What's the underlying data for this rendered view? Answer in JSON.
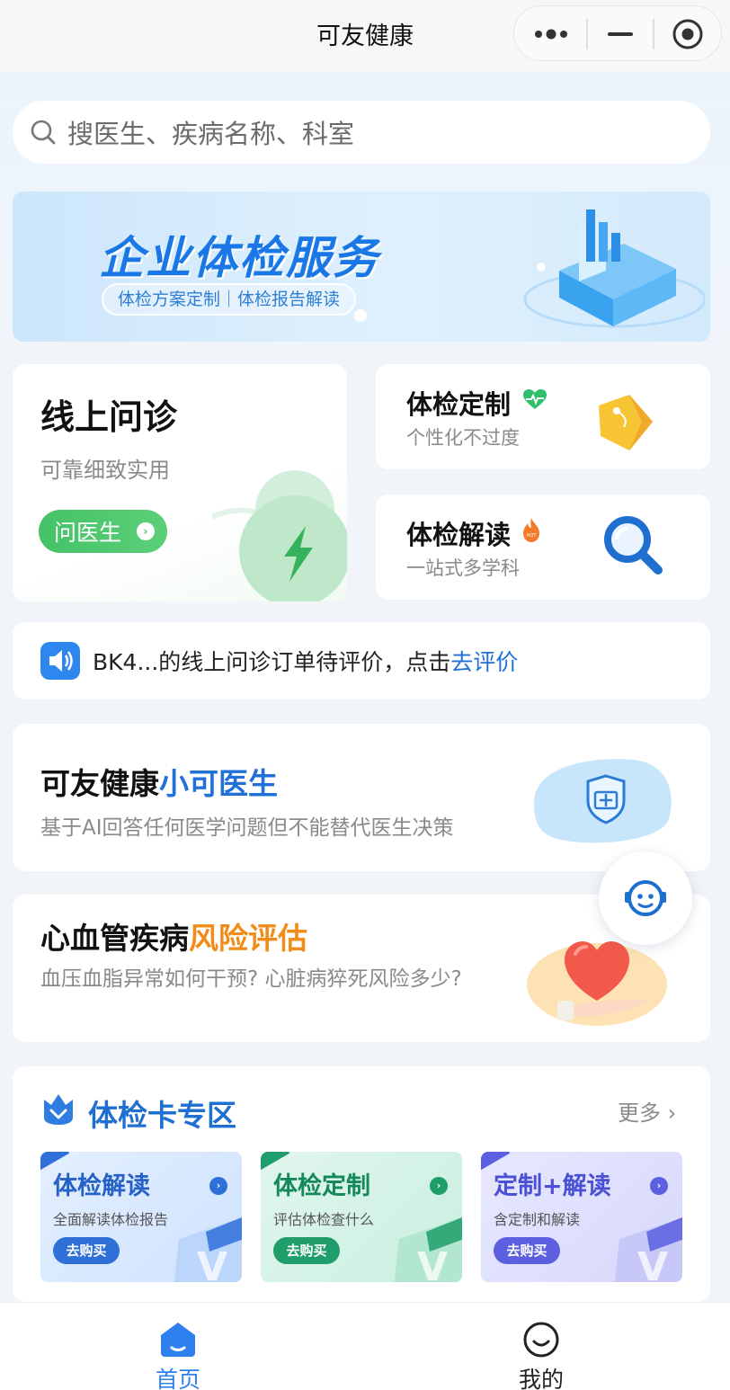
{
  "app": {
    "title": "可友健康"
  },
  "search": {
    "placeholder": "搜医生、疾病名称、科室"
  },
  "banner": {
    "title": "企业体检服务",
    "tagline": "体检方案定制｜体检报告解读"
  },
  "consult": {
    "title": "线上问诊",
    "subtitle": "可靠细致实用",
    "button": "问医生"
  },
  "service_cards": [
    {
      "title": "体检定制",
      "subtitle": "个性化不过度",
      "badge_icon": "heart-pulse-icon"
    },
    {
      "title": "体检解读",
      "subtitle": "一站式多学科",
      "badge_icon": "hot-flame-icon",
      "badge_text": "HOT"
    }
  ],
  "notice": {
    "text": "BK4...的线上问诊订单待评价，点击",
    "link": "去评价"
  },
  "ai_doctor": {
    "title_prefix": "可友健康",
    "title_highlight": "小可医生",
    "subtitle": "基于AI回答任何医学问题但不能替代医生决策"
  },
  "cardio": {
    "title_prefix": "心血管疾病",
    "title_highlight": "风险评估",
    "subtitle": "血压血脂异常如何干预? 心脏病猝死风险多少?"
  },
  "card_zone": {
    "title": "体检卡专区",
    "more": "更多",
    "products": [
      {
        "title": "体检解读",
        "subtitle": "全面解读体检报告",
        "button": "去购买",
        "color": "#2f6fd8"
      },
      {
        "title": "体检定制",
        "subtitle": "评估体检查什么",
        "button": "去购买",
        "color": "#1f9d6a"
      },
      {
        "title": "定制+解读",
        "subtitle": "含定制和解读",
        "button": "去购买",
        "color": "#5b5fe0"
      }
    ]
  },
  "tabbar": {
    "items": [
      {
        "label": "首页",
        "active": true,
        "icon": "home-icon"
      },
      {
        "label": "我的",
        "active": false,
        "icon": "smile-icon"
      }
    ]
  },
  "colors": {
    "brand_blue": "#1f70d9",
    "green": "#44c267",
    "orange": "#f08c17"
  }
}
